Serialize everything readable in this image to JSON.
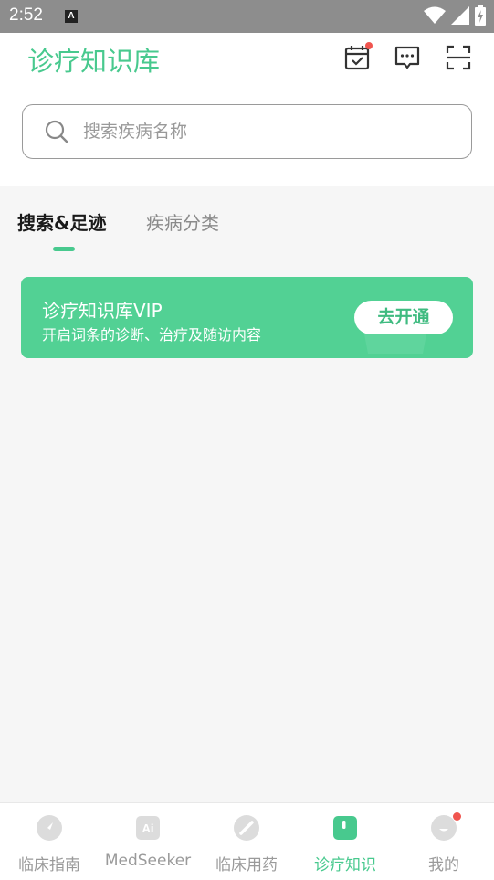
{
  "status_bar": {
    "time": "2:52",
    "indicator": "A"
  },
  "header": {
    "logo": "诊疗知识库",
    "icons": [
      "calendar-check-icon",
      "message-icon",
      "scan-icon"
    ]
  },
  "search": {
    "placeholder": "搜索疾病名称"
  },
  "tabs": [
    {
      "label": "搜索&足迹",
      "active": true
    },
    {
      "label": "疾病分类",
      "active": false
    }
  ],
  "vip": {
    "title": "诊疗知识库VIP",
    "subtitle": "开启词条的诊断、治疗及随访内容",
    "button": "去开通"
  },
  "bottom_nav": [
    {
      "label": "临床指南",
      "icon": "compass-icon",
      "active": false
    },
    {
      "label": "MedSeeker",
      "icon": "ai-icon",
      "active": false
    },
    {
      "label": "临床用药",
      "icon": "pill-icon",
      "active": false
    },
    {
      "label": "诊疗知识",
      "icon": "book-icon",
      "active": true
    },
    {
      "label": "我的",
      "icon": "profile-icon",
      "active": false
    }
  ],
  "colors": {
    "accent": "#48c98e",
    "vip_bg": "#52d194",
    "badge": "#f0554f"
  }
}
